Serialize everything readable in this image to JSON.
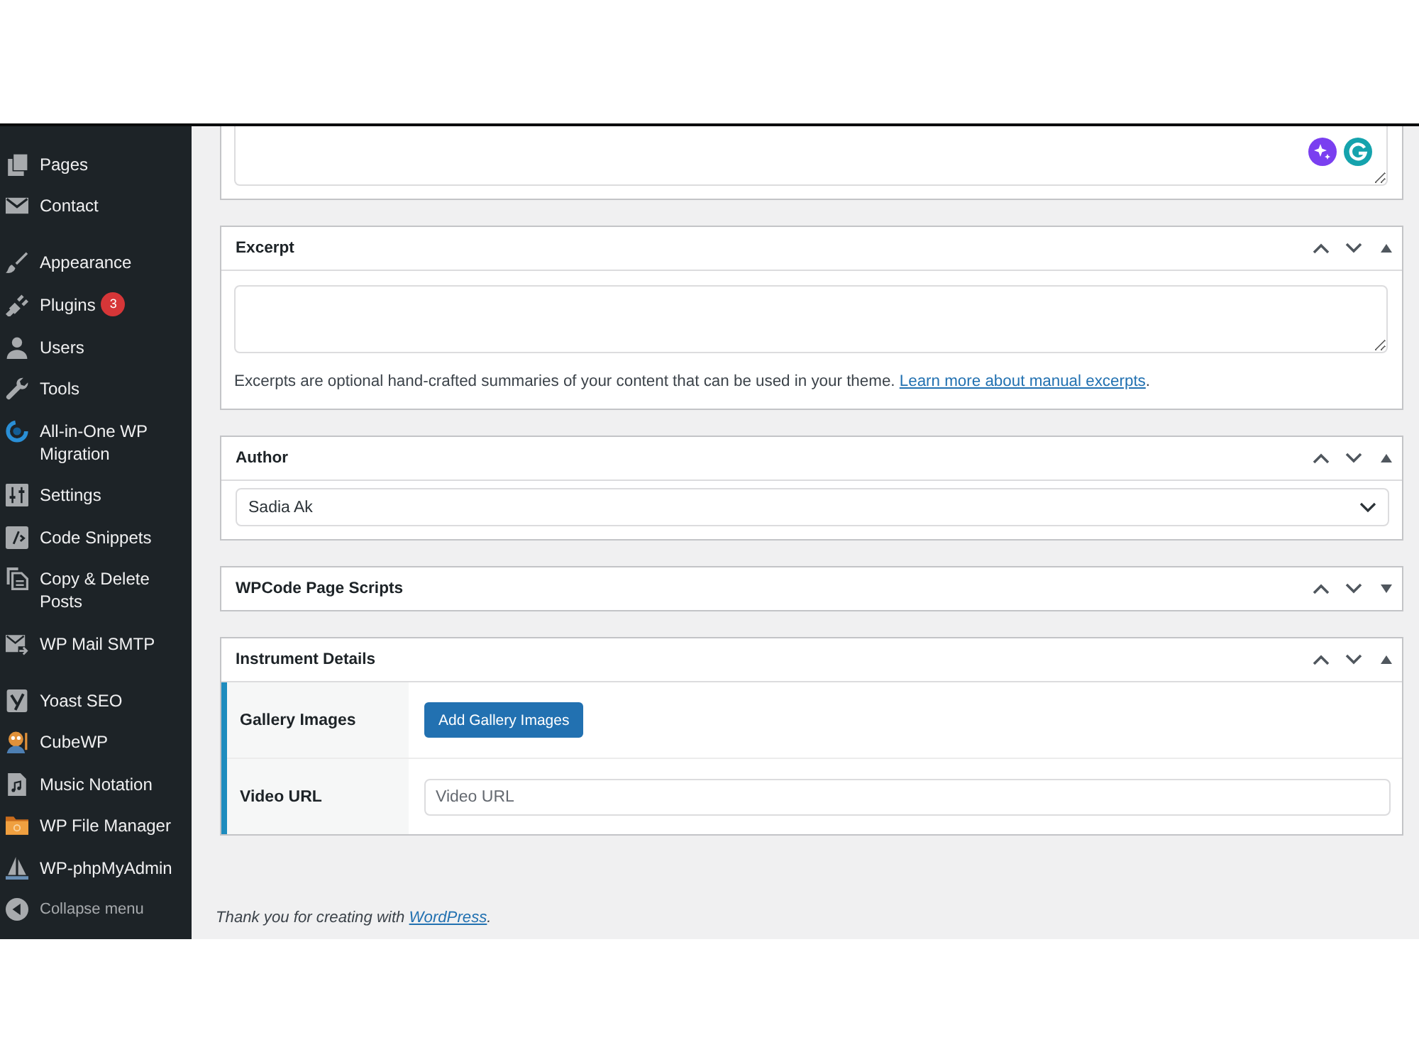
{
  "sidebar": {
    "groups": [
      [
        {
          "label": "Pages"
        },
        {
          "label": "Contact"
        }
      ],
      [
        {
          "label": "Appearance"
        },
        {
          "label": "Plugins",
          "badge": "3"
        },
        {
          "label": "Users"
        },
        {
          "label": "Tools"
        },
        {
          "label": "All-in-One WP Migration"
        },
        {
          "label": "Settings"
        },
        {
          "label": "Code Snippets"
        },
        {
          "label": "Copy & Delete Posts"
        },
        {
          "label": "WP Mail SMTP"
        }
      ],
      [
        {
          "label": "Yoast SEO"
        },
        {
          "label": "CubeWP"
        },
        {
          "label": "Music Notation"
        },
        {
          "label": "WP File Manager"
        },
        {
          "label": "WP-phpMyAdmin"
        }
      ]
    ],
    "collapse": "Collapse menu"
  },
  "panels": [
    {
      "kind": "textarea",
      "title": "Excerpt",
      "expanded": true,
      "help": "Excerpts are optional hand-crafted summaries of your content that can be used in your theme.",
      "help_link": "Learn more about manual excerpts",
      "help_after": "."
    },
    {
      "kind": "select",
      "title": "Author",
      "expanded": true,
      "value": "Sadia Ak"
    },
    {
      "title": "WPCode Page Scripts",
      "expanded": false
    },
    {
      "kind": "fields",
      "title": "Instrument Details",
      "expanded": true,
      "rows": [
        {
          "kind": "button",
          "label": "Gallery Images",
          "button": "Add Gallery Images"
        },
        {
          "kind": "input",
          "label": "Video URL",
          "placeholder": "Video URL"
        }
      ]
    }
  ],
  "footer": {
    "text": "Thank you for creating with",
    "link": "WordPress",
    "after": "."
  }
}
